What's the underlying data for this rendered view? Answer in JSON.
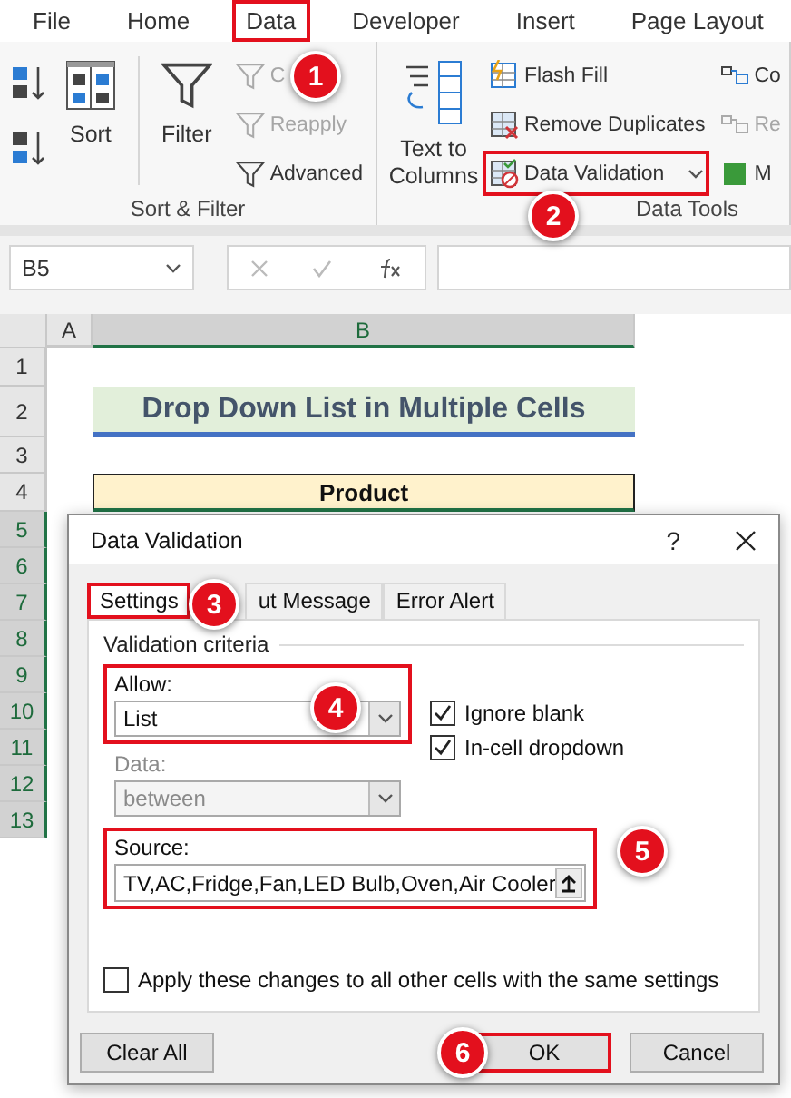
{
  "ribbon_tabs": [
    {
      "label": "File",
      "highlighted": false
    },
    {
      "label": "Home",
      "highlighted": false
    },
    {
      "label": "Data",
      "highlighted": true
    },
    {
      "label": "Developer",
      "highlighted": false
    },
    {
      "label": "Insert",
      "highlighted": false
    },
    {
      "label": "Page Layout",
      "highlighted": false
    }
  ],
  "sort_filter": {
    "label": "Sort & Filter",
    "sort": "Sort",
    "filter": "Filter",
    "small_buttons": [
      {
        "label": "C",
        "disabled": true
      },
      {
        "label": "Reapply",
        "disabled": true
      },
      {
        "label": "Advanced",
        "disabled": false
      }
    ]
  },
  "data_tools": {
    "label": "Data Tools",
    "text_to_columns": "Text to Columns",
    "small_buttons": [
      {
        "label": "Flash Fill",
        "highlighted": false
      },
      {
        "label": "Remove Duplicates",
        "highlighted": false
      },
      {
        "label": "Data Validation",
        "highlighted": true
      }
    ],
    "more_buttons": [
      {
        "label": "Co",
        "disabled": false
      },
      {
        "label": "Re",
        "disabled": true
      },
      {
        "label": "M",
        "disabled": false
      }
    ]
  },
  "formula_bar": {
    "name_box": "B5"
  },
  "sheet": {
    "columns": [
      {
        "label": "A",
        "selected": false
      },
      {
        "label": "B",
        "selected": true
      }
    ],
    "rows": [
      {
        "label": "1",
        "selected": false
      },
      {
        "label": "2",
        "selected": false,
        "cell": {
          "kind": "title",
          "text": "Drop Down List in Multiple Cells"
        }
      },
      {
        "label": "3",
        "selected": false
      },
      {
        "label": "4",
        "selected": false,
        "cell": {
          "kind": "header",
          "text": "Product"
        }
      },
      {
        "label": "5",
        "selected": true
      },
      {
        "label": "6",
        "selected": true
      },
      {
        "label": "7",
        "selected": true
      },
      {
        "label": "8",
        "selected": true
      },
      {
        "label": "9",
        "selected": true
      },
      {
        "label": "10",
        "selected": true
      },
      {
        "label": "11",
        "selected": true
      },
      {
        "label": "12",
        "selected": true
      },
      {
        "label": "13",
        "selected": true
      }
    ]
  },
  "dialog": {
    "title": "Data Validation",
    "help": "?",
    "tabs": [
      {
        "label": "Settings",
        "selected": true,
        "highlighted": true
      },
      {
        "label": "ut Message",
        "selected": false,
        "highlighted": false
      },
      {
        "label": "Error Alert",
        "selected": false,
        "highlighted": false
      }
    ],
    "section": "Validation criteria",
    "allow": {
      "label": "Allow:",
      "value": "List",
      "highlighted": true
    },
    "data": {
      "label": "Data:",
      "value": "between",
      "disabled": true
    },
    "checkboxes": [
      {
        "label": "Ignore blank",
        "checked": true
      },
      {
        "label": "In-cell dropdown",
        "checked": true
      }
    ],
    "source": {
      "label": "Source:",
      "value": "TV,AC,Fridge,Fan,LED Bulb,Oven,Air Cooler",
      "highlighted": true
    },
    "apply": {
      "label": "Apply these changes to all other cells with the same settings",
      "checked": false
    },
    "buttons": [
      {
        "label": "Clear All",
        "highlighted": false
      },
      {
        "label": "OK",
        "highlighted": true
      },
      {
        "label": "Cancel",
        "highlighted": false
      }
    ]
  },
  "callouts": [
    "1",
    "2",
    "3",
    "4",
    "5",
    "6"
  ]
}
